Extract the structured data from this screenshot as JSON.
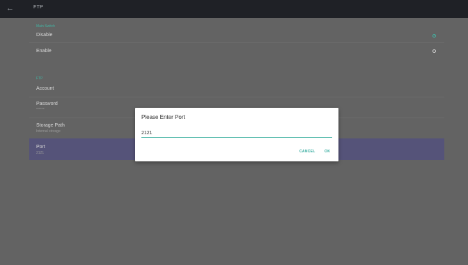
{
  "header": {
    "title": "FTP",
    "back_icon": "back-arrow-icon"
  },
  "main_switch": {
    "header": "Main Switch",
    "options": [
      {
        "label": "Disable",
        "selected": true
      },
      {
        "label": "Enable",
        "selected": false
      }
    ]
  },
  "ftp": {
    "header": "FTP",
    "account": {
      "label": "Account"
    },
    "password": {
      "label": "Password",
      "value": "******"
    },
    "storage_path": {
      "label": "Storage Path",
      "value": "Internal storage"
    },
    "port": {
      "label": "Port",
      "value": "2121"
    }
  },
  "dialog": {
    "title": "Please Enter Port",
    "input_value": "2121",
    "cancel_label": "CANCEL",
    "ok_label": "OK"
  },
  "colors": {
    "accent": "#43b3a2",
    "background": "#636363",
    "topbar": "#1f2126",
    "selected_row": "#555379"
  }
}
